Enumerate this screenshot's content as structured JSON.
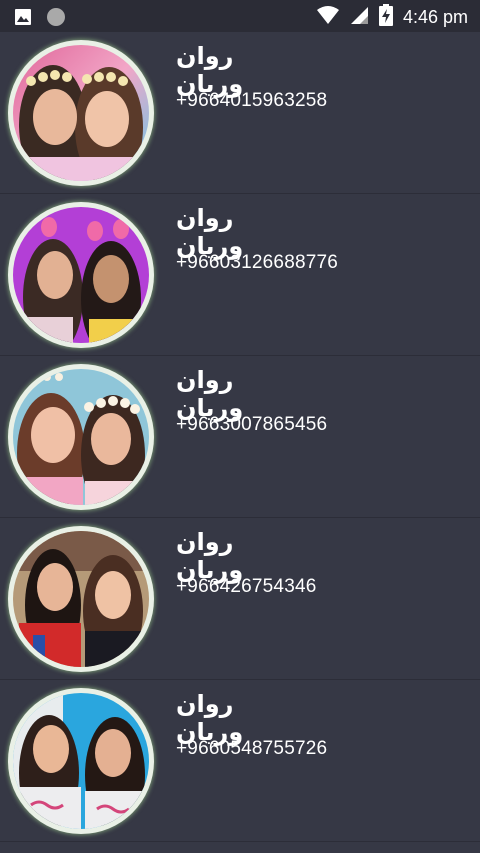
{
  "status_bar": {
    "time": "4:46 pm",
    "icons": [
      "image-icon",
      "circle-notification-icon",
      "wifi-icon",
      "cell-signal-icon",
      "battery-charging-icon"
    ]
  },
  "contacts": [
    {
      "name": "روان وريان",
      "phone": "+9664015963258"
    },
    {
      "name": "روان وريان",
      "phone": "+96603126688776"
    },
    {
      "name": "روان وريان",
      "phone": "+9663007865456"
    },
    {
      "name": "روان وريان",
      "phone": "+966426754346"
    },
    {
      "name": "روان وريان",
      "phone": "+9660548755726"
    }
  ]
}
